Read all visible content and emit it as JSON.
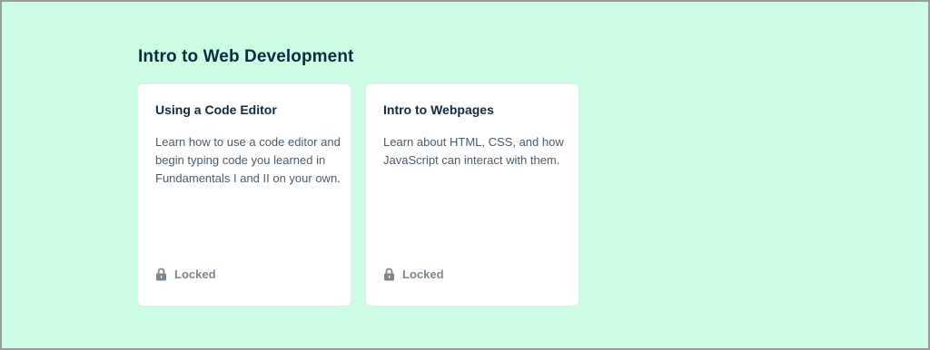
{
  "section": {
    "title": "Intro to Web Development"
  },
  "cards": [
    {
      "title": "Using a Code Editor",
      "description": "Learn how to use a code editor and begin typing code you learned in Fundamentals I and II on your own.",
      "status": "Locked",
      "icon": "lock-icon"
    },
    {
      "title": "Intro to Webpages",
      "description": "Learn about HTML, CSS, and how JavaScript can interact with them.",
      "status": "Locked",
      "icon": "lock-icon"
    }
  ],
  "colors": {
    "background": "#ccfde4",
    "card": "#ffffff",
    "heading": "#0d2a40",
    "body_text": "#4b5b68",
    "status_text": "#7a8791",
    "frame_border": "#9a9a9a"
  }
}
